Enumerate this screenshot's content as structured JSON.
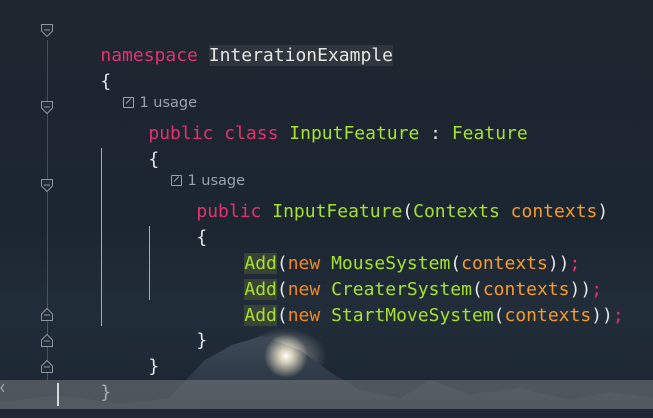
{
  "code": {
    "line1": {
      "keyword": "namespace",
      "name": "InterationExample"
    },
    "line2": {
      "brace": "{"
    },
    "hint1": {
      "text": "1 usage"
    },
    "line3": {
      "kw1": "public",
      "kw2": "class",
      "name": "InputFeature",
      "colon": ":",
      "base": "Feature"
    },
    "line4": {
      "brace": "{"
    },
    "hint2": {
      "text": "1 usage"
    },
    "line5": {
      "kw": "public",
      "name": "InputFeature",
      "open": "(",
      "ptype": "Contexts",
      "pname": "contexts",
      "close": ")"
    },
    "line6": {
      "brace": "{"
    },
    "line7": {
      "method": "Add",
      "open": "(",
      "kw": "new",
      "type": "MouseSystem",
      "open2": "(",
      "arg": "contexts",
      "close": "))",
      "semi": ";"
    },
    "line8": {
      "method": "Add",
      "open": "(",
      "kw": "new",
      "type": "CreaterSystem",
      "open2": "(",
      "arg": "contexts",
      "close": "))",
      "semi": ";"
    },
    "line9": {
      "method": "Add",
      "open": "(",
      "kw": "new",
      "type": "StartMoveSystem",
      "open2": "(",
      "arg": "contexts",
      "close": "))",
      "semi": ";"
    },
    "line10": {
      "brace": "}"
    },
    "line11": {
      "brace": "}"
    },
    "line12": {
      "brace": "}"
    }
  },
  "icons": {
    "fold": "fold-marker-icon",
    "usage": "navigate-usage-icon"
  },
  "colors": {
    "keyword": "#e5316f",
    "type": "#a6e22e",
    "param": "#f59c2f",
    "text": "#e6e6e6",
    "hint": "#9aa3ad",
    "guide": "#c9b138"
  }
}
